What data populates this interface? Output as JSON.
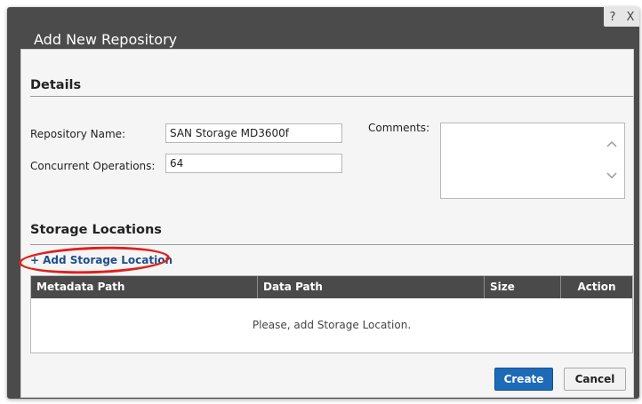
{
  "dialog": {
    "title": "Add New Repository",
    "help_label": "?",
    "close_label": "X"
  },
  "details": {
    "heading": "Details",
    "repository_name_label": "Repository Name:",
    "repository_name_value": "SAN Storage MD3600f",
    "concurrent_operations_label": "Concurrent Operations:",
    "concurrent_operations_value": "64",
    "comments_label": "Comments:",
    "comments_value": ""
  },
  "storage": {
    "heading": "Storage Locations",
    "add_link_plus": "+",
    "add_link_label": "Add Storage Location",
    "columns": [
      "Metadata Path",
      "Data Path",
      "Size",
      "Action"
    ],
    "empty_message": "Please, add Storage Location."
  },
  "footer": {
    "create_label": "Create",
    "cancel_label": "Cancel"
  },
  "colors": {
    "titlebar": "#4b4b4b",
    "panel": "#f5f5f5",
    "table_header": "#4a4a4a",
    "primary_button": "#1d6bb8",
    "link": "#1f4e8c",
    "highlight_annotation": "#e0201b"
  },
  "icons": {
    "scroll_up": "chevron-up-icon",
    "scroll_down": "chevron-down-icon",
    "help": "help-icon",
    "close": "close-icon"
  }
}
